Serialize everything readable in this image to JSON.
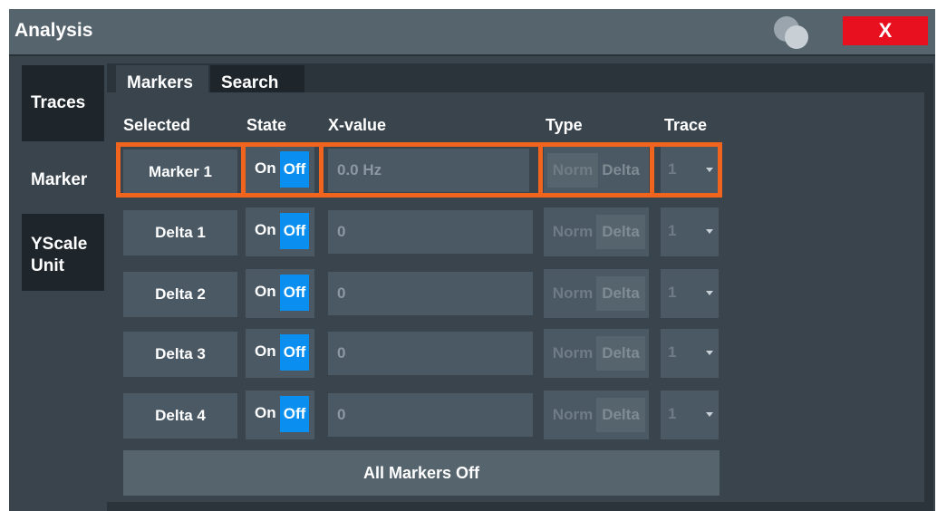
{
  "window": {
    "title": "Analysis",
    "close_label": "X"
  },
  "side_tabs": [
    {
      "label": "Traces"
    },
    {
      "label": "Marker"
    },
    {
      "label": "YScale Unit"
    }
  ],
  "tabs": [
    {
      "label": "Markers"
    },
    {
      "label": "Search"
    }
  ],
  "columns": {
    "selected": "Selected",
    "state": "State",
    "xvalue": "X-value",
    "type": "Type",
    "trace": "Trace"
  },
  "rows": [
    {
      "name": "Marker 1",
      "on": "On",
      "off": "Off",
      "x_value": "0.0 Hz",
      "norm": "Norm",
      "delta": "Delta",
      "trace": "1"
    },
    {
      "name": "Delta 1",
      "on": "On",
      "off": "Off",
      "x_value": "0",
      "norm": "Norm",
      "delta": "Delta",
      "trace": "1"
    },
    {
      "name": "Delta 2",
      "on": "On",
      "off": "Off",
      "x_value": "0",
      "norm": "Norm",
      "delta": "Delta",
      "trace": "1"
    },
    {
      "name": "Delta 3",
      "on": "On",
      "off": "Off",
      "x_value": "0",
      "norm": "Norm",
      "delta": "Delta",
      "trace": "1"
    },
    {
      "name": "Delta 4",
      "on": "On",
      "off": "Off",
      "x_value": "0",
      "norm": "Norm",
      "delta": "Delta",
      "trace": "1"
    }
  ],
  "all_markers_off_label": "All Markers Off",
  "colors": {
    "accent_orange": "#f0641e",
    "toggle_blue": "#0a8ff0",
    "close_red": "#e8101e"
  }
}
